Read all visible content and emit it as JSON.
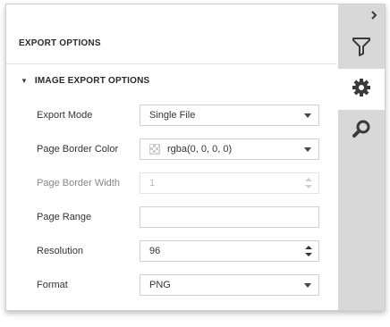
{
  "panel": {
    "title": "EXPORT OPTIONS",
    "group_title": "IMAGE EXPORT OPTIONS",
    "group_expanded_icon": "triangle-down-icon"
  },
  "sidebar": {
    "collapse_icon": "chevron-right-icon",
    "tabs": [
      {
        "icon": "filter-icon",
        "active": false
      },
      {
        "icon": "gear-icon",
        "active": true
      },
      {
        "icon": "search-icon",
        "active": false
      }
    ]
  },
  "fields": {
    "export_mode": {
      "label": "Export Mode",
      "value": "Single File"
    },
    "page_border_color": {
      "label": "Page Border Color",
      "value": "rgba(0, 0, 0, 0)"
    },
    "page_border_width": {
      "label": "Page Border Width",
      "value": "1",
      "disabled": true
    },
    "page_range": {
      "label": "Page Range",
      "value": ""
    },
    "resolution": {
      "label": "Resolution",
      "value": "96"
    },
    "format": {
      "label": "Format",
      "value": "PNG"
    }
  },
  "colors": {
    "sidebar_bg": "#d8d8d8",
    "active_tab_bg": "#ffffff",
    "icon_color": "#3a3a3a"
  }
}
